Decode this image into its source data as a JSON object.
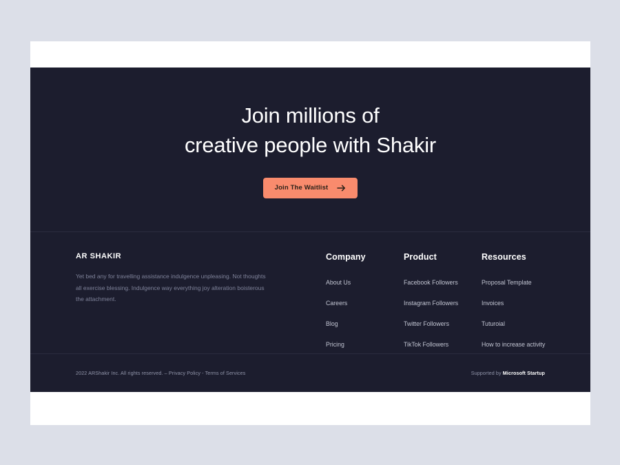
{
  "theme": {
    "page_background": "#dcdfe8",
    "card_background": "#ffffff",
    "panel_background": "#1c1d2e",
    "accent": "#f98b6d",
    "heading_text": "#ffffff",
    "muted_text": "#7f839a",
    "link_text": "#c2c5d2",
    "divider": "#2b2c3f"
  },
  "hero": {
    "title_line_1": "Join millions of",
    "title_line_2": "creative people with Shakir",
    "cta_label": "Join The Waitlist",
    "cta_icon": "arrow-right-icon"
  },
  "footer": {
    "brand": {
      "name": "AR SHAKIR",
      "description": "Yet bed any for travelling assistance indulgence unpleasing. Not thoughts all exercise blessing. Indulgence way everything joy alteration boisterous the attachment."
    },
    "columns": [
      {
        "title": "Company",
        "links": [
          "About Us",
          "Careers",
          "Blog",
          "Pricing"
        ]
      },
      {
        "title": "Product",
        "links": [
          "Facebook Followers",
          "Instagram Followers",
          "Twitter Followers",
          "TikTok Followers"
        ]
      },
      {
        "title": "Resources",
        "links": [
          "Proposal Template",
          "Invoices",
          "Tuturoial",
          "How to increase activity"
        ]
      }
    ],
    "bottom": {
      "copyright": "2022 ARShakir Inc. All rights reserved.",
      "separator_1": "–",
      "privacy_label": "Privacy Policy",
      "separator_2": "-",
      "terms_label": "Terms of Services",
      "supported_prefix": "Supported by",
      "supported_brand": "Microsoft Startup"
    }
  }
}
